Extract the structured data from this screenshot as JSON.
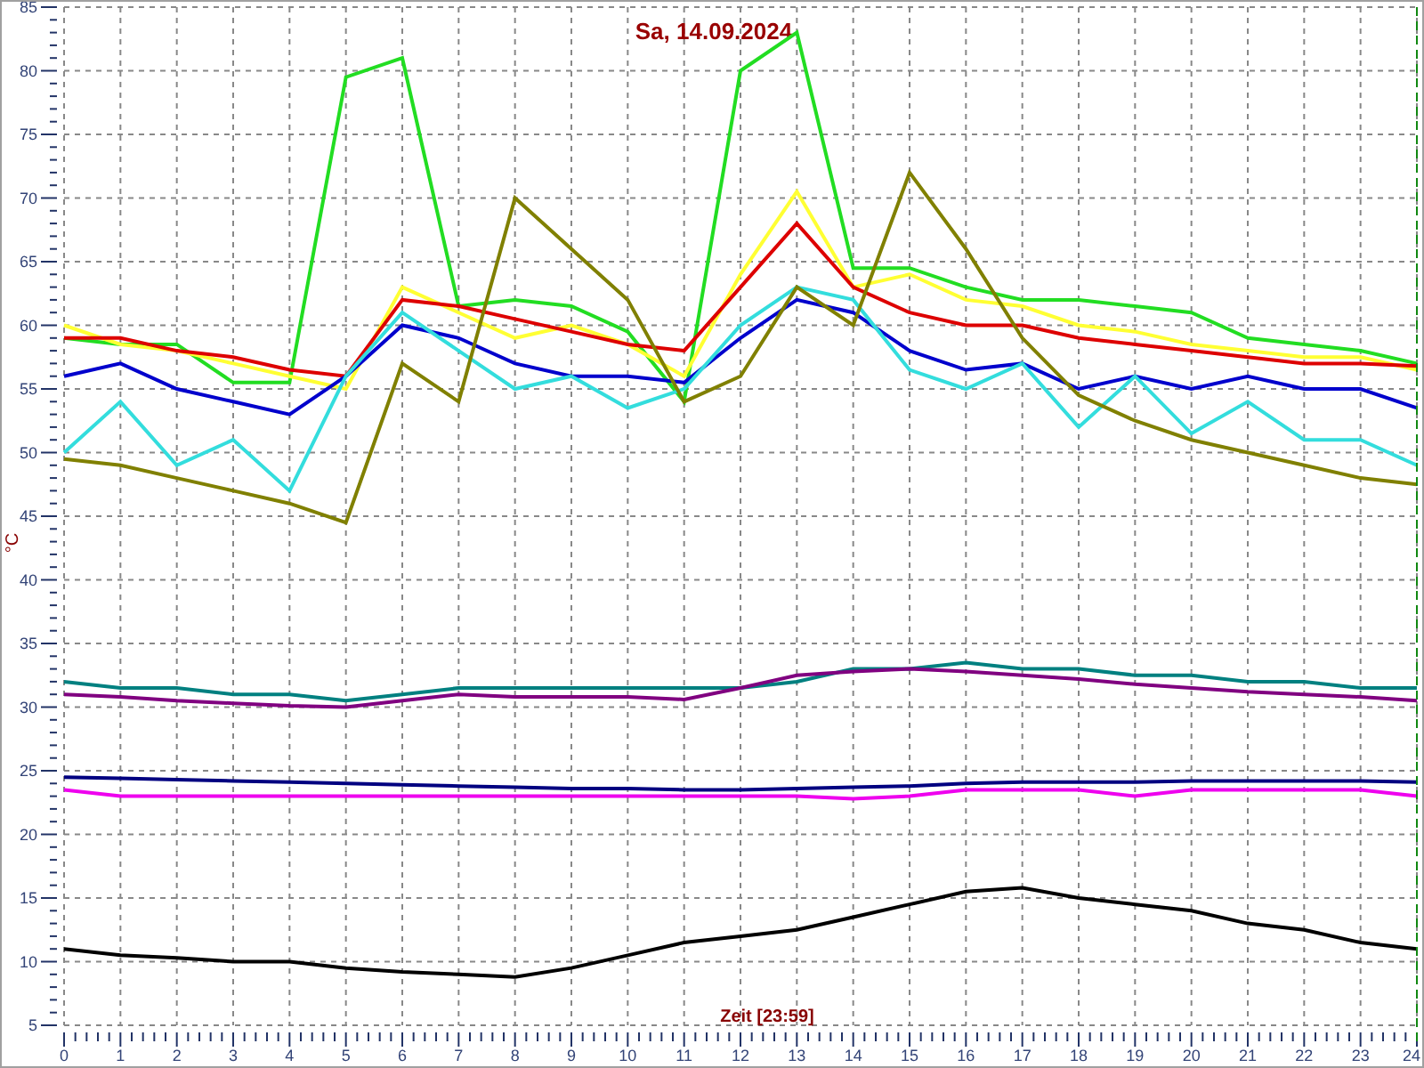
{
  "chart": {
    "chart_data": {
      "type": "line",
      "title": "Sa, 14.09.2024",
      "xlabel": "Zeit [23:59]",
      "ylabel": "°C",
      "x": [
        0,
        1,
        2,
        3,
        4,
        5,
        6,
        7,
        8,
        9,
        10,
        11,
        12,
        13,
        14,
        15,
        16,
        17,
        18,
        19,
        20,
        21,
        22,
        23,
        24
      ],
      "grid": true,
      "xlim": [
        0,
        24
      ],
      "ylim": [
        5,
        85
      ],
      "xticks": [
        0,
        1,
        2,
        3,
        4,
        5,
        6,
        7,
        8,
        9,
        10,
        11,
        12,
        13,
        14,
        15,
        16,
        17,
        18,
        19,
        20,
        21,
        22,
        23,
        24
      ],
      "yticks": [
        5,
        10,
        15,
        20,
        25,
        30,
        35,
        40,
        45,
        50,
        55,
        60,
        65,
        70,
        75,
        80,
        85
      ],
      "series": [
        {
          "color": "#22dd22",
          "values": [
            59,
            58.5,
            58.5,
            55.5,
            55.5,
            79.5,
            81,
            61.5,
            62,
            61.5,
            59.5,
            54,
            80,
            83,
            64.5,
            64.5,
            63,
            62,
            62,
            61.5,
            61,
            59,
            58.5,
            58,
            57
          ]
        },
        {
          "color": "#ffff33",
          "values": [
            60,
            58.5,
            58,
            57,
            56,
            55,
            63,
            61,
            59,
            60,
            58.5,
            56,
            64,
            70.5,
            63,
            64,
            62,
            61.5,
            60,
            59.5,
            58.5,
            58,
            57.5,
            57.5,
            56.5
          ]
        },
        {
          "color": "#dd0000",
          "values": [
            59,
            59,
            58,
            57.5,
            56.5,
            56,
            62,
            61.5,
            60.5,
            59.5,
            58.5,
            58,
            63,
            68,
            63,
            61,
            60,
            60,
            59,
            58.5,
            58,
            57.5,
            57,
            57,
            56.8
          ]
        },
        {
          "color": "#0000cc",
          "values": [
            56,
            57,
            55,
            54,
            53,
            56,
            60,
            59,
            57,
            56,
            56,
            55.5,
            59,
            62,
            61,
            58,
            56.5,
            57,
            55,
            56,
            55,
            56,
            55,
            55,
            53.5
          ]
        },
        {
          "color": "#33dddd",
          "values": [
            50,
            54,
            49,
            51,
            47,
            56,
            61,
            58,
            55,
            56,
            53.5,
            55,
            60,
            63,
            62,
            56.5,
            55,
            57,
            52,
            56,
            51.5,
            54,
            51,
            51,
            49
          ]
        },
        {
          "color": "#808000",
          "values": [
            49.5,
            49,
            48,
            47,
            46,
            44.5,
            57,
            54,
            70,
            66,
            62,
            54,
            56,
            63,
            60,
            72,
            66,
            59,
            54.5,
            52.5,
            51,
            50,
            49,
            48,
            47.5
          ]
        },
        {
          "color": "#008080",
          "values": [
            32,
            31.5,
            31.5,
            31,
            31,
            30.5,
            31,
            31.5,
            31.5,
            31.5,
            31.5,
            31.5,
            31.5,
            32,
            33,
            33,
            33.5,
            33,
            33,
            32.5,
            32.5,
            32,
            32,
            31.5,
            31.5
          ]
        },
        {
          "color": "#800080",
          "values": [
            31,
            30.8,
            30.5,
            30.3,
            30.1,
            30,
            30.5,
            31,
            30.8,
            30.8,
            30.8,
            30.6,
            31.5,
            32.5,
            32.8,
            33,
            32.8,
            32.5,
            32.2,
            31.8,
            31.5,
            31.2,
            31,
            30.8,
            30.5
          ]
        },
        {
          "color": "#000080",
          "values": [
            24.5,
            24.4,
            24.3,
            24.2,
            24.1,
            24,
            23.9,
            23.8,
            23.7,
            23.6,
            23.6,
            23.5,
            23.5,
            23.6,
            23.7,
            23.8,
            24,
            24.1,
            24.1,
            24.1,
            24.2,
            24.2,
            24.2,
            24.2,
            24.1
          ]
        },
        {
          "color": "#ee00ee",
          "values": [
            23.5,
            23,
            23,
            23,
            23,
            23,
            23,
            23,
            23,
            23,
            23,
            23,
            23,
            23,
            22.8,
            23,
            23.5,
            23.5,
            23.5,
            23,
            23.5,
            23.5,
            23.5,
            23.5,
            23
          ]
        },
        {
          "color": "#000000",
          "values": [
            11,
            10.5,
            10.3,
            10,
            10,
            9.5,
            9.2,
            9,
            8.8,
            9.5,
            10.5,
            11.5,
            12,
            12.5,
            13.5,
            14.5,
            15.5,
            15.8,
            15,
            14.5,
            14,
            13,
            12.5,
            11.5,
            11
          ]
        }
      ]
    }
  }
}
